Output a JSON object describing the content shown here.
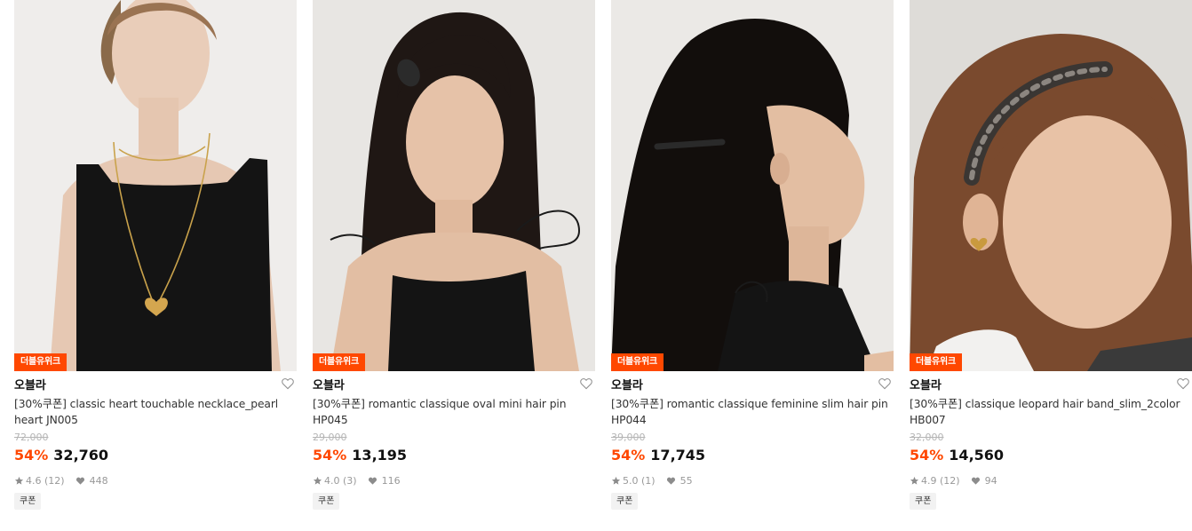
{
  "products": [
    {
      "tag": "더블유위크",
      "brand": "오블라",
      "title": "[30%쿠폰] classic heart touchable necklace_pearl heart JN005",
      "original_price": "72,000",
      "discount": "54%",
      "price": "32,760",
      "rating": "4.6",
      "reviews": "(12)",
      "likes": "448",
      "coupon": "쿠폰",
      "image_desc": "woman-black-camisole-heart-necklace"
    },
    {
      "tag": "더블유위크",
      "brand": "오블라",
      "title": "[30%쿠폰] romantic classique oval mini hair pin HP045",
      "original_price": "29,000",
      "discount": "54%",
      "price": "13,195",
      "rating": "4.0",
      "reviews": "(3)",
      "likes": "116",
      "coupon": "쿠폰",
      "image_desc": "woman-long-hair-oval-pin"
    },
    {
      "tag": "더블유위크",
      "brand": "오블라",
      "title": "[30%쿠폰] romantic classique feminine slim hair pin HP044",
      "original_price": "39,000",
      "discount": "54%",
      "price": "17,745",
      "rating": "5.0",
      "reviews": "(1)",
      "likes": "55",
      "coupon": "쿠폰",
      "image_desc": "woman-profile-slim-hair-pin"
    },
    {
      "tag": "더블유위크",
      "brand": "오블라",
      "title": "[30%쿠폰] classique leopard hair band_slim_2color HB007",
      "original_price": "32,000",
      "discount": "54%",
      "price": "14,560",
      "rating": "4.9",
      "reviews": "(12)",
      "likes": "94",
      "coupon": "쿠폰",
      "image_desc": "smiling-woman-leopard-headband"
    }
  ],
  "colors": {
    "accent": "#ff4800",
    "text": "#111111",
    "muted": "#999999",
    "strike": "#b5b5b5"
  },
  "icons": [
    "heart-outline-icon",
    "star-icon",
    "heart-filled-icon"
  ]
}
